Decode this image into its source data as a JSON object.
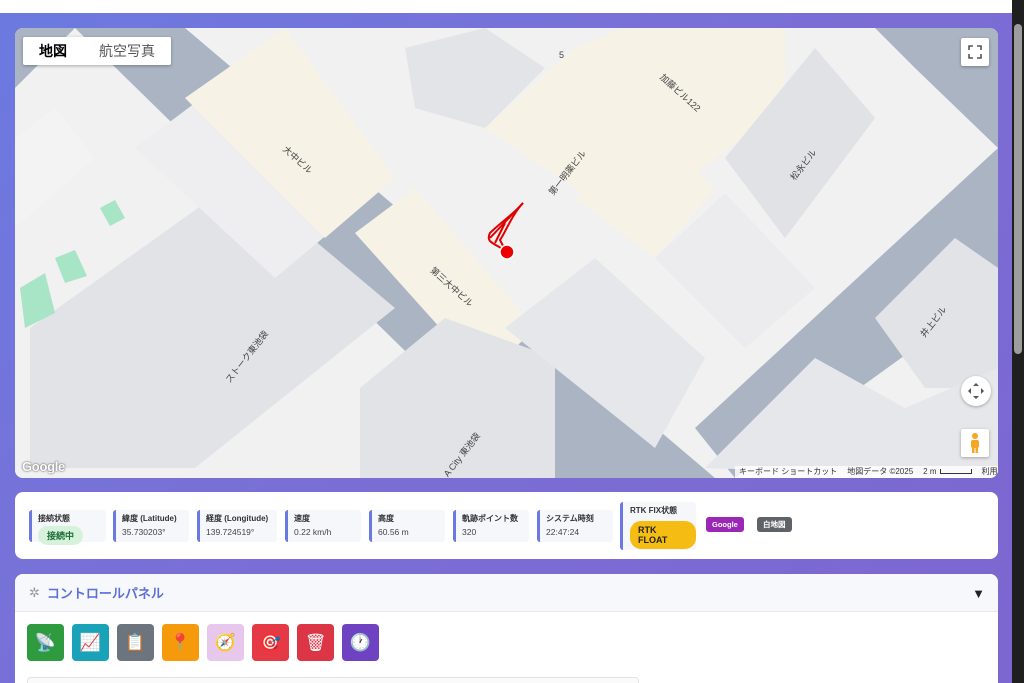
{
  "map": {
    "tabs": [
      "地図",
      "航空写真"
    ],
    "active_tab": "地図",
    "labels": {
      "block_number": "5",
      "kato": "加藤ビル122",
      "daiichi": "第一明薬ビル",
      "matsunaga": "松永ビル",
      "onaka": "大中ビル",
      "daisan": "第三大中ビル",
      "stork": "ストーク東池袋",
      "city": "A City 東池袋",
      "inoue": "井上ビル"
    },
    "google_logo": "Google",
    "attribution": {
      "shortcuts": "キーボード ショートカット",
      "map_data": "地図データ ©2025",
      "scale": "2 m",
      "terms": "利用規約"
    },
    "colors": {
      "road": "#aab4c3",
      "building": "#e8e9ec",
      "highlight_building": "#f6f3e6",
      "track": "#e00000",
      "marker": "#ee0000",
      "park": "#a8e4c6"
    },
    "icons": [
      "fullscreen-icon",
      "camera-control-icon",
      "pegman-icon"
    ]
  },
  "status": {
    "connection": {
      "label": "接続状態",
      "value": "接続中"
    },
    "latitude": {
      "label": "緯度 (Latitude)",
      "value": "35.730203°"
    },
    "longitude": {
      "label": "経度 (Longitude)",
      "value": "139.724519°"
    },
    "speed": {
      "label": "速度",
      "value": "0.22 km/h"
    },
    "altitude": {
      "label": "高度",
      "value": "60.56 m"
    },
    "track_points": {
      "label": "軌跡ポイント数",
      "value": "320"
    },
    "system_time": {
      "label": "システム時刻",
      "value": "22:47:24"
    },
    "rtk": {
      "label": "RTK FIX状態",
      "value": "RTK FLOAT"
    },
    "map_buttons": [
      "Google",
      "白地図"
    ]
  },
  "control_panel": {
    "title": "コントロールパネル",
    "toggle": "▼",
    "gear": "✲",
    "tools": [
      {
        "name": "satellite-icon",
        "glyph": "📡",
        "color": "#2e9b3f"
      },
      {
        "name": "chart-icon",
        "glyph": "📈",
        "color": "#1aa3b8"
      },
      {
        "name": "clipboard-icon",
        "glyph": "📋",
        "color": "#6c757d"
      },
      {
        "name": "pin-icon",
        "glyph": "📍",
        "color": "#f59b0b"
      },
      {
        "name": "compass-icon",
        "glyph": "🧭",
        "color": "#e7c8ec"
      },
      {
        "name": "target-icon",
        "glyph": "🎯",
        "color": "#e63946"
      },
      {
        "name": "trash-icon",
        "glyph": "🗑",
        "color": "#dc3545"
      },
      {
        "name": "clock-icon",
        "glyph": "🕐",
        "color": "#6f42c1"
      }
    ]
  }
}
